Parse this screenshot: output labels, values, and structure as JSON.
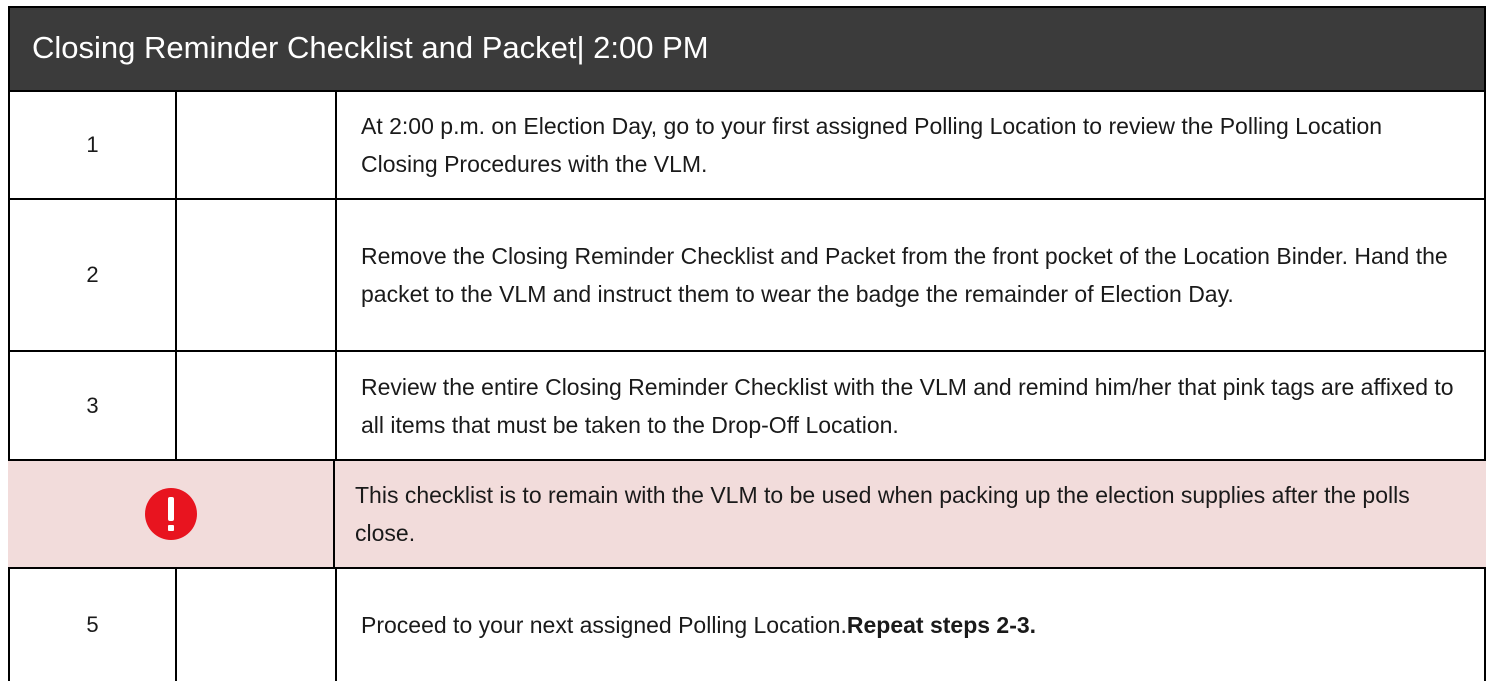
{
  "header": {
    "title": "Closing Reminder Checklist and Packet| 2:00 PM"
  },
  "rows": [
    {
      "num": "1",
      "text": "At 2:00 p.m. on Election Day, go to your first assigned Polling Location to review the Polling Location Closing Procedures with the VLM."
    },
    {
      "num": "2",
      "text": "Remove the Closing Reminder Checklist and Packet from the front pocket of the Location Binder.  Hand the packet to the VLM and instruct them to wear the badge the remainder of Election Day."
    },
    {
      "num": "3",
      "text": "Review the entire Closing Reminder Checklist with the VLM and remind him/her that pink tags are affixed to all items that must be taken to the Drop-Off Location."
    },
    {
      "icon": "exclamation-alert-icon",
      "text": "This checklist is to remain with the VLM to be used when packing up the election supplies after the polls close."
    },
    {
      "num": "5",
      "text": "Proceed to your next assigned Polling Location. ",
      "emphasis": "Repeat steps 2-3."
    }
  ],
  "colors": {
    "header_bg": "#3b3b3b",
    "alert_bg": "#f2dcdb",
    "alert_icon": "#e8141f"
  }
}
